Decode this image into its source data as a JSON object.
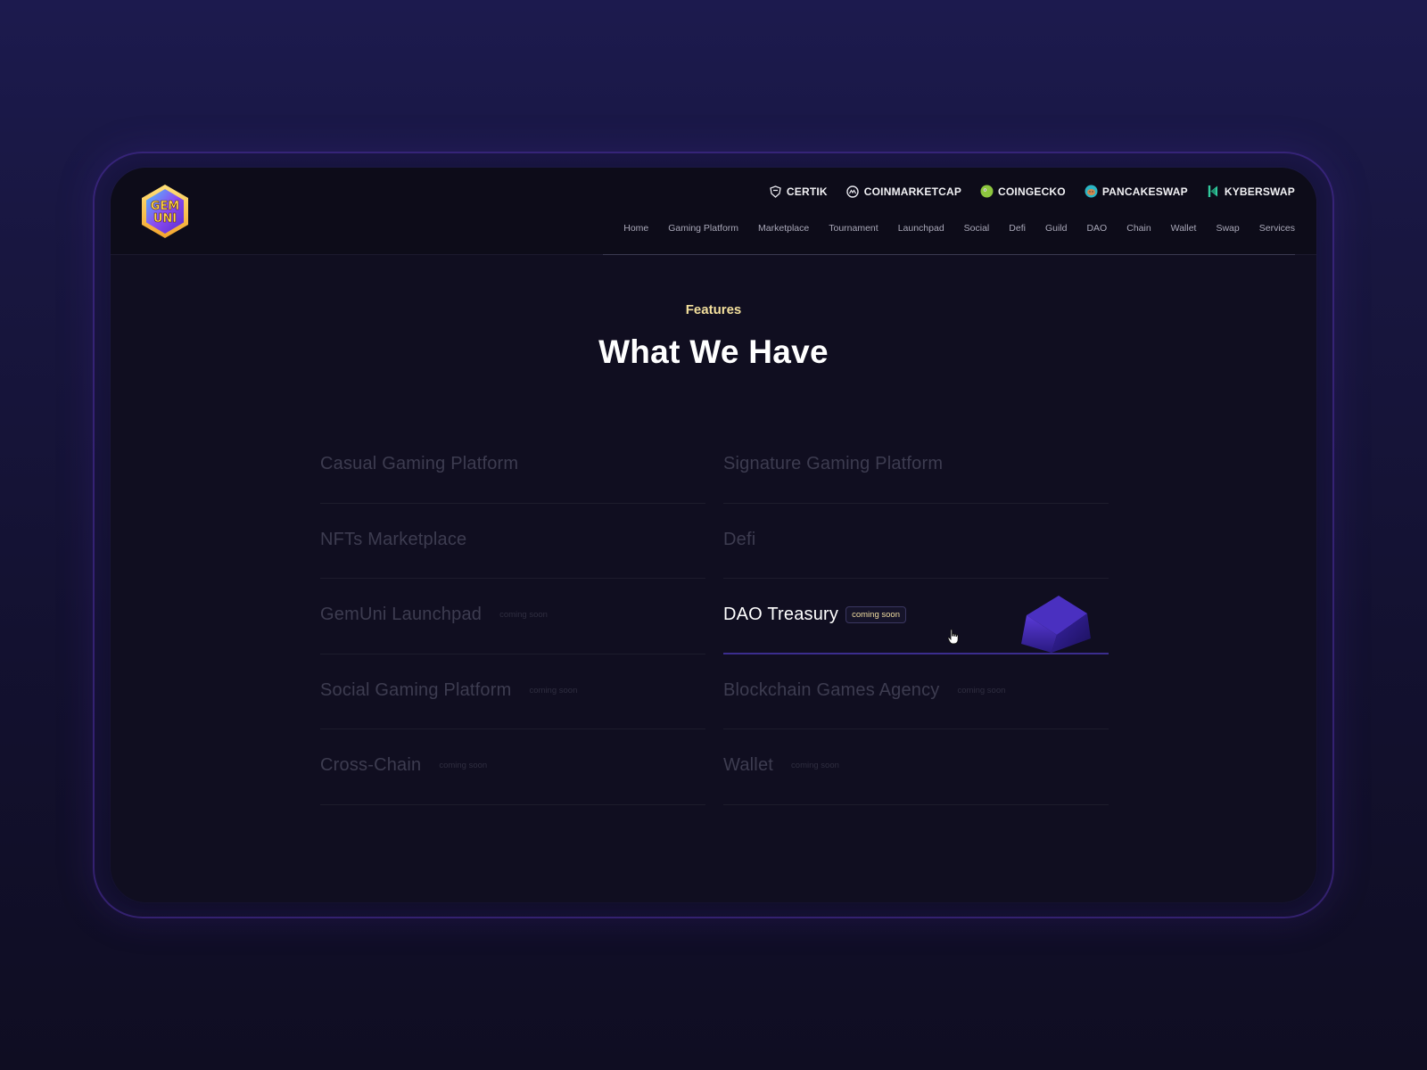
{
  "partners": [
    {
      "label": "CERTIK",
      "icon": "certik-shield-icon"
    },
    {
      "label": "COINMARKETCAP",
      "icon": "coinmarketcap-icon"
    },
    {
      "label": "COINGECKO",
      "icon": "coingecko-icon"
    },
    {
      "label": "PANCAKESWAP",
      "icon": "pancakeswap-icon"
    },
    {
      "label": "KYBERSWAP",
      "icon": "kyberswap-icon"
    }
  ],
  "nav": [
    "Home",
    "Gaming Platform",
    "Marketplace",
    "Tournament",
    "Launchpad",
    "Social",
    "Defi",
    "Guild",
    "DAO",
    "Chain",
    "Wallet",
    "Swap",
    "Services"
  ],
  "logo": {
    "line1": "GEM",
    "line2": "UNI"
  },
  "section": {
    "eyebrow": "Features",
    "title": "What We Have"
  },
  "features": [
    {
      "title": "Casual Gaming Platform",
      "badge": ""
    },
    {
      "title": "Signature Gaming Platform",
      "badge": ""
    },
    {
      "title": "NFTs Marketplace",
      "badge": ""
    },
    {
      "title": "Defi",
      "badge": ""
    },
    {
      "title": "GemUni Launchpad",
      "badge": "coming soon"
    },
    {
      "title": "DAO Treasury",
      "badge": "coming soon",
      "active": true
    },
    {
      "title": "Social Gaming Platform",
      "badge": "coming soon"
    },
    {
      "title": "Blockchain Games Agency",
      "badge": "coming soon"
    },
    {
      "title": "Cross-Chain",
      "badge": "coming soon"
    },
    {
      "title": "Wallet",
      "badge": "coming soon"
    }
  ],
  "colors": {
    "accent_gold": "#f3df9c",
    "accent_purple": "#3b2d8e",
    "background": "#100e20"
  }
}
